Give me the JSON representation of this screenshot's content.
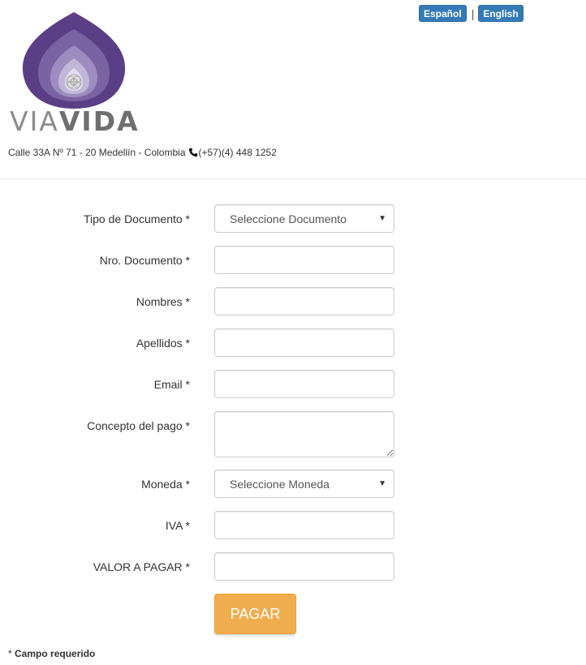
{
  "header": {
    "languages": [
      "Español",
      "English"
    ],
    "separator": "|",
    "brand_light": "VIA",
    "brand_bold": "VIDA",
    "address": "Calle 33A Nº 71 - 20 Medellín - Colombia",
    "phone": "(+57)(4) 448 1252"
  },
  "form": {
    "doc_type_label": "Tipo de Documento *",
    "doc_type_value": "Seleccione Documento",
    "doc_number_label": "Nro. Documento *",
    "names_label": "Nombres *",
    "surnames_label": "Apellidos *",
    "email_label": "Email *",
    "concept_label": "Concepto del pago *",
    "currency_label": "Moneda *",
    "currency_value": "Seleccione Moneda",
    "iva_label": "IVA *",
    "amount_label": "VALOR A PAGAR *",
    "submit_label": "PAGAR"
  },
  "footer": {
    "required_prefix": "* ",
    "required_text": "Campo requerido"
  },
  "colors": {
    "language_button": "#337ab7",
    "pay_button": "#f0ad4e",
    "logo_purple": "#5b3f86"
  },
  "icons": [
    "phone-icon",
    "chevron-down-icon"
  ]
}
